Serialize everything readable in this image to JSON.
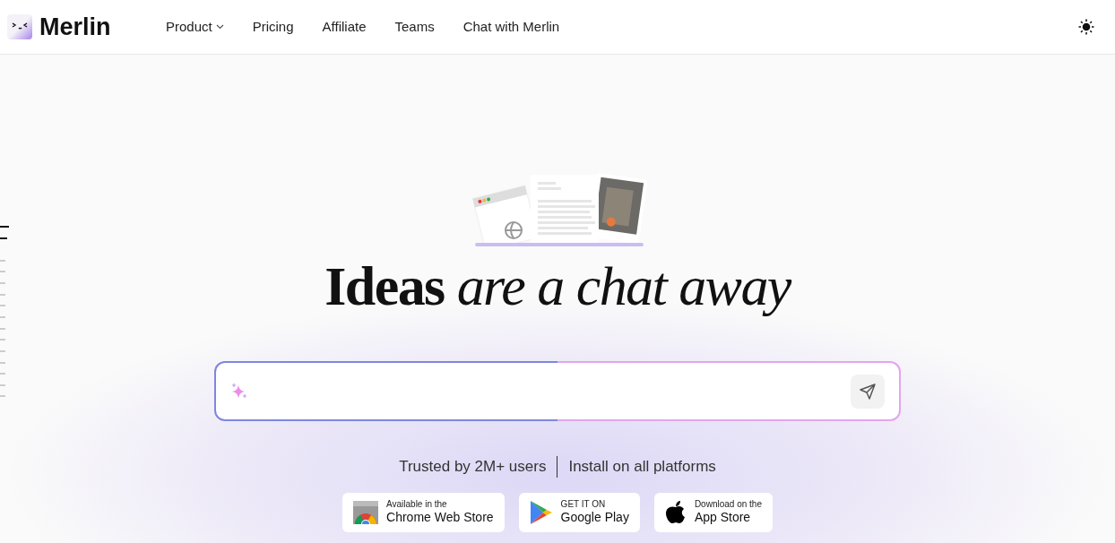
{
  "header": {
    "logo_text": "Merlin",
    "nav": [
      {
        "label": "Product",
        "kind": "dropdown"
      },
      {
        "label": "Pricing",
        "kind": "link"
      },
      {
        "label": "Affiliate",
        "kind": "link"
      },
      {
        "label": "Teams",
        "kind": "link"
      },
      {
        "label": "Chat with Merlin",
        "kind": "link"
      }
    ]
  },
  "hero": {
    "heading": "**Ideas** *are a chat away*",
    "trust_text": "Trusted by 2M+ users",
    "install_text": "Install on all platforms"
  },
  "stores": [
    {
      "kind": "chrome",
      "small": "Available in the",
      "large": "Chrome Web Store"
    },
    {
      "kind": "google",
      "small": "GET IT ON",
      "large": "Google Play"
    },
    {
      "kind": "apple",
      "small": "Download on the",
      "large": "App Store"
    }
  ]
}
